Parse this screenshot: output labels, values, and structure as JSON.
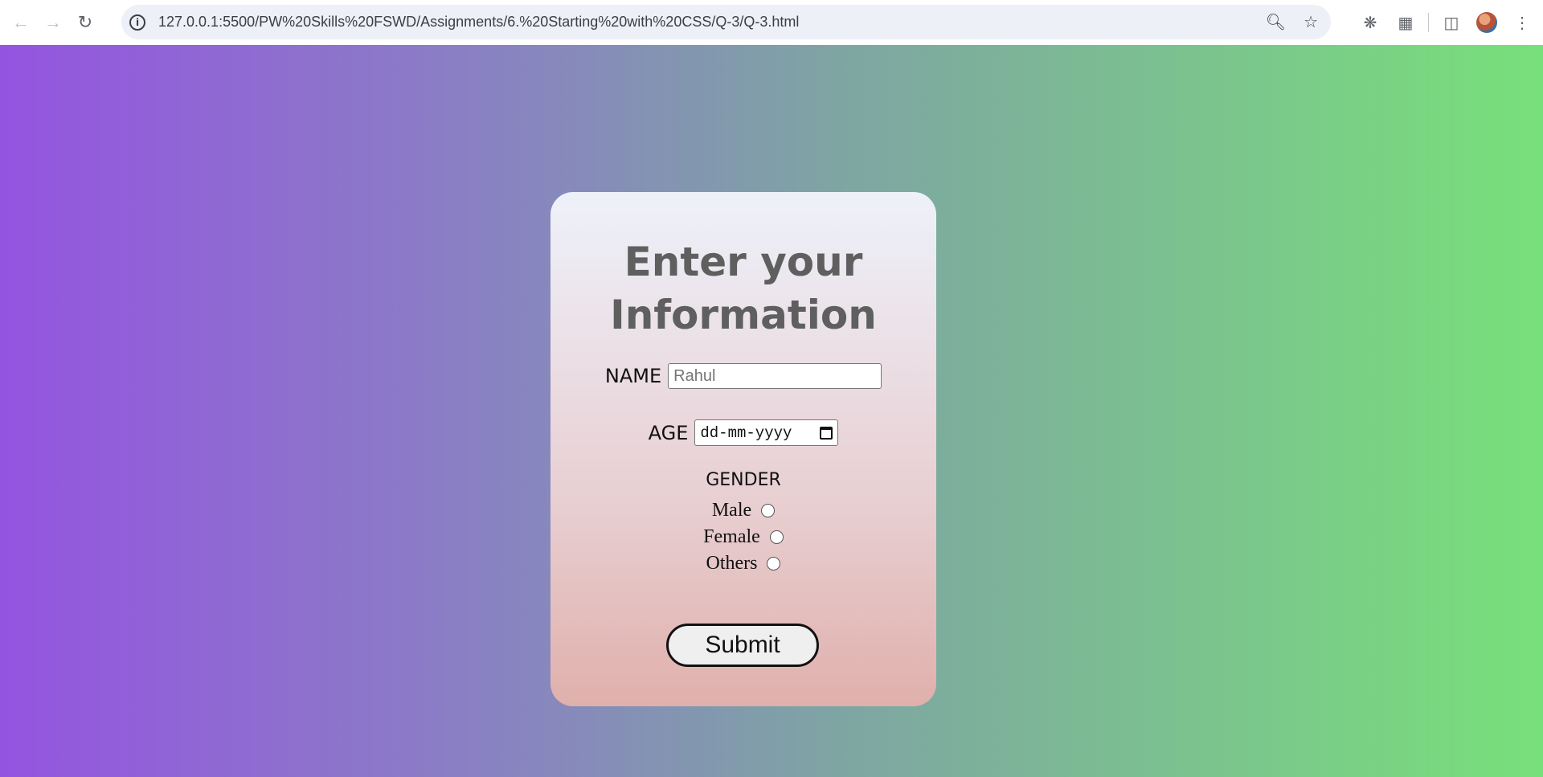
{
  "browser": {
    "url": "127.0.0.1:5500/PW%20Skills%20FSWD/Assignments/6.%20Starting%20with%20CSS/Q-3/Q-3.html",
    "icons": [
      "back-icon",
      "forward-icon",
      "reload-icon",
      "site-info-icon",
      "zoom-icon",
      "bookmark-star-icon",
      "bug-extension-icon",
      "extensions-icon",
      "side-panel-icon",
      "profile-avatar",
      "more-menu-icon"
    ]
  },
  "form": {
    "title_line1": "Enter your",
    "title_line2": "Information",
    "name_label": "NAME",
    "name_placeholder": "Rahul",
    "age_label": "AGE",
    "age_placeholder": "dd-mm-yyyy",
    "gender_label": "GENDER",
    "gender_options": [
      "Male",
      "Female",
      "Others"
    ],
    "submit_label": "Submit"
  },
  "colors": {
    "gradient_left": "#9454e0",
    "gradient_right": "#78e07a",
    "title_color": "#5f5f5f"
  }
}
